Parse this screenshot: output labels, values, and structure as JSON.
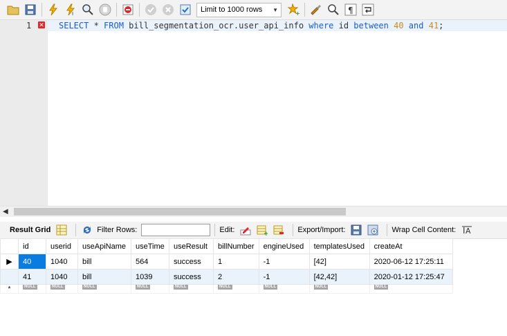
{
  "toolbar": {
    "limit_label": "Limit to 1000 rows"
  },
  "editor": {
    "line_number": "1",
    "query": {
      "t1": "SELECT",
      "t2": " * ",
      "t3": "FROM",
      "t4": " bill_segmentation_ocr.user_api_info ",
      "t5": "where",
      "t6": " id ",
      "t7": "between",
      "t8": " ",
      "t9": "40",
      "t10": " ",
      "t11": "and",
      "t12": " ",
      "t13": "41",
      "t14": ";"
    }
  },
  "result_toolbar": {
    "result_grid": "Result Grid",
    "filter_rows": "Filter Rows:",
    "edit": "Edit:",
    "export_import": "Export/Import:",
    "wrap_cell": "Wrap Cell Content:"
  },
  "grid": {
    "columns": [
      "id",
      "userid",
      "useApiName",
      "useTime",
      "useResult",
      "billNumber",
      "engineUsed",
      "templatesUsed",
      "createAt"
    ],
    "rows": [
      [
        "40",
        "1040",
        "bill",
        "564",
        "success",
        "1",
        "-1",
        "[42]",
        "2020-06-12 17:25:11"
      ],
      [
        "41",
        "1040",
        "bill",
        "1039",
        "success",
        "2",
        "-1",
        "[42,42]",
        "2020-01-12 17:25:47"
      ]
    ],
    "null_label": "NULL",
    "new_row_marker": "*"
  },
  "colors": {
    "keyword": "#1d5cc4",
    "number": "#c98a1e",
    "selection": "#0a7be0",
    "alt_row": "#eaf3fb"
  }
}
